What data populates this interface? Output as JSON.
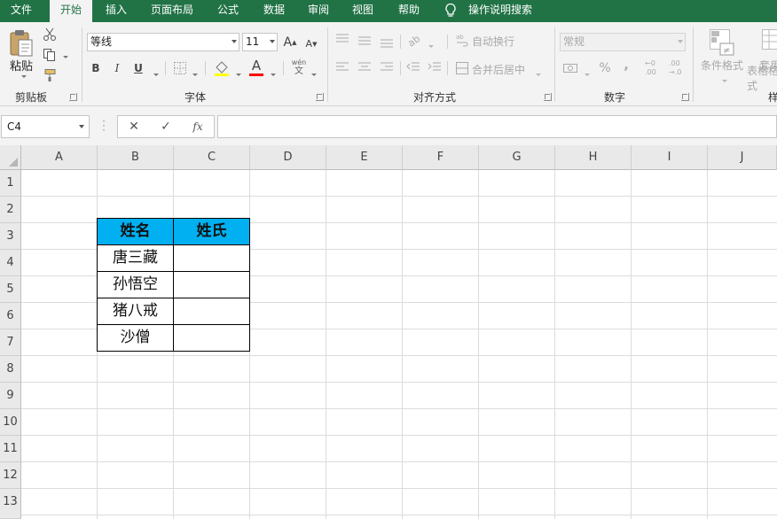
{
  "menu": {
    "tabs": [
      "文件",
      "开始",
      "插入",
      "页面布局",
      "公式",
      "数据",
      "审阅",
      "视图",
      "帮助"
    ],
    "active_tab": "开始",
    "tell_me": "操作说明搜索"
  },
  "ribbon": {
    "clipboard": {
      "paste_label": "粘贴",
      "group_label": "剪贴板"
    },
    "font": {
      "font_name": "等线",
      "font_size": "11",
      "bold": "B",
      "italic": "I",
      "underline": "U",
      "font_color_glyph": "A",
      "phonetic_top": "wén",
      "phonetic_bottom": "文",
      "group_label": "字体"
    },
    "alignment": {
      "wrap_text": "自动换行",
      "merge_center": "合并后居中",
      "group_label": "对齐方式"
    },
    "number": {
      "format": "常规",
      "percent": "%",
      "comma": ",",
      "inc_decimal": ".00",
      "group_label": "数字"
    },
    "styles": {
      "conditional_format": "条件格式",
      "table_format_line1": "套用",
      "table_format_line2": "表格格式",
      "group_label_partial": "样"
    }
  },
  "formula_bar": {
    "name_box": "C4",
    "cancel_glyph": "✕",
    "enter_glyph": "✓",
    "fx_glyph": "fx",
    "formula": ""
  },
  "sheet": {
    "columns": [
      "A",
      "B",
      "C",
      "D",
      "E",
      "F",
      "G",
      "H",
      "I",
      "J"
    ],
    "rows": [
      "1",
      "2",
      "3",
      "4",
      "5",
      "6",
      "7",
      "8",
      "9",
      "10",
      "11",
      "12",
      "13"
    ],
    "table": {
      "header": [
        "姓名",
        "姓氏"
      ],
      "rows": [
        [
          "唐三藏",
          ""
        ],
        [
          "孙悟空",
          ""
        ],
        [
          "猪八戒",
          ""
        ],
        [
          "沙僧",
          ""
        ]
      ]
    },
    "colors": {
      "header_fill": "#00b0f0",
      "ribbon_green": "#217346"
    }
  }
}
